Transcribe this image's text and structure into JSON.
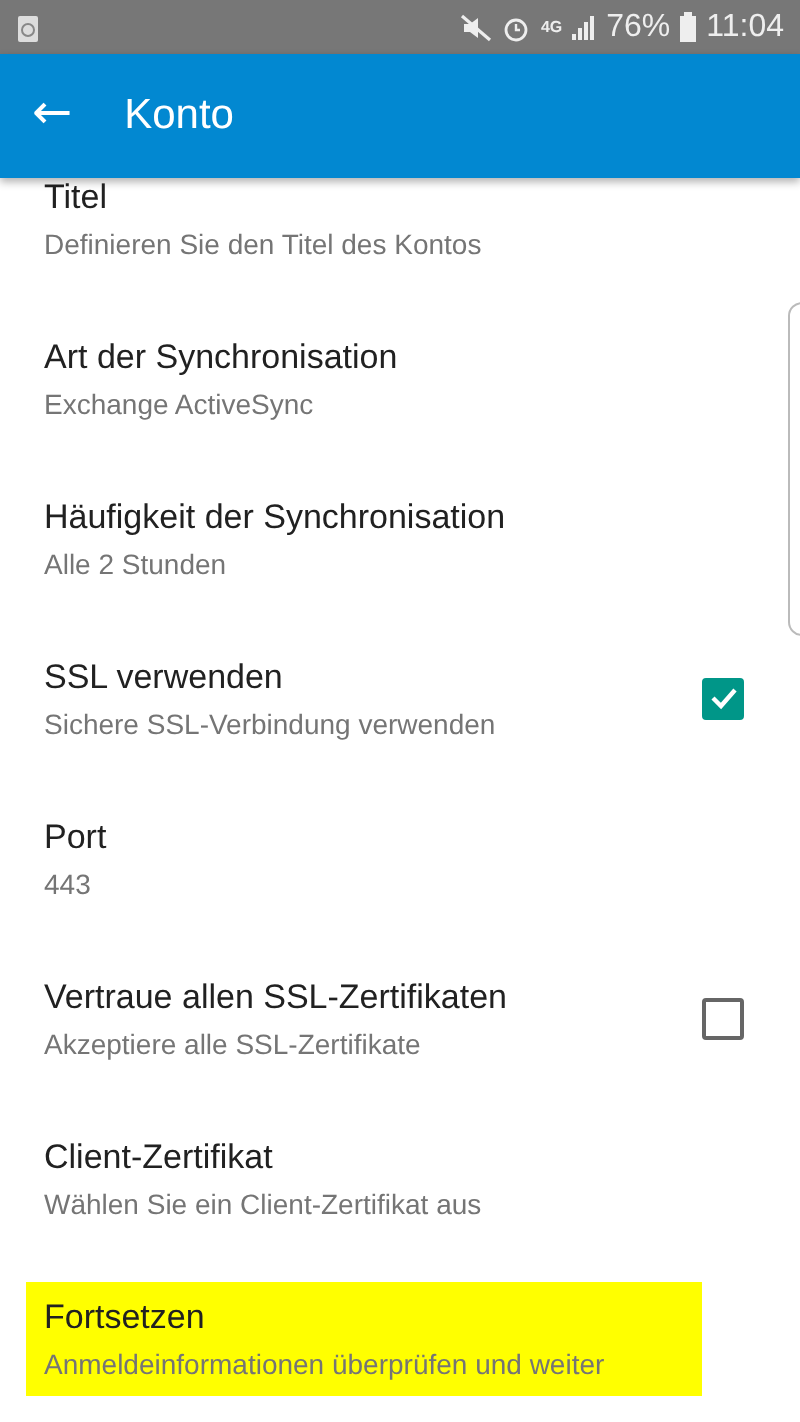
{
  "status_bar": {
    "battery": "76%",
    "time": "11:04",
    "network": "4G"
  },
  "app_bar": {
    "back_icon": "←",
    "title": "Konto"
  },
  "settings": [
    {
      "kind": "plain",
      "title": "Titel",
      "subtitle": "Definieren Sie den Titel des Kontos",
      "highlighted": false
    },
    {
      "kind": "plain",
      "title": "Art der Synchronisation",
      "subtitle": "Exchange ActiveSync",
      "highlighted": false
    },
    {
      "kind": "plain",
      "title": "Häufigkeit der Synchronisation",
      "subtitle": "Alle 2 Stunden",
      "highlighted": false
    },
    {
      "kind": "checkbox",
      "title": "SSL verwenden",
      "subtitle": "Sichere SSL-Verbindung verwenden",
      "checked": true,
      "highlighted": false
    },
    {
      "kind": "plain",
      "title": "Port",
      "subtitle": "443",
      "highlighted": false
    },
    {
      "kind": "checkbox",
      "title": "Vertraue allen SSL-Zertifikaten",
      "subtitle": "Akzeptiere alle SSL-Zertifikate",
      "checked": false,
      "highlighted": false
    },
    {
      "kind": "plain",
      "title": "Client-Zertifikat",
      "subtitle": "Wählen Sie ein Client-Zertifikat aus",
      "highlighted": false
    },
    {
      "kind": "plain",
      "title": "Fortsetzen",
      "subtitle": "Anmeldeinformationen überprüfen und weiter",
      "highlighted": true
    }
  ]
}
